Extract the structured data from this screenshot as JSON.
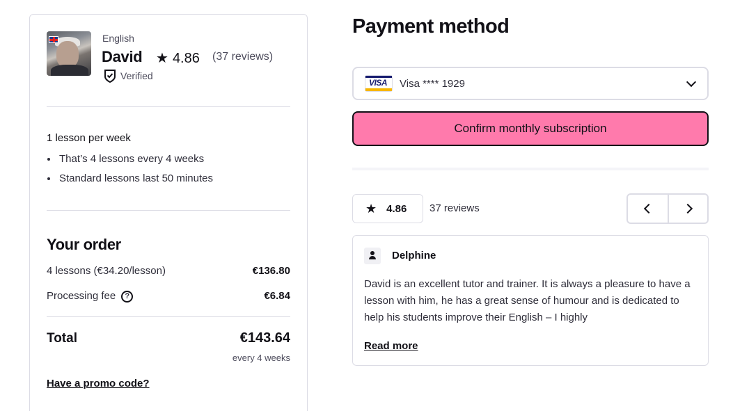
{
  "tutor": {
    "language": "English",
    "name": "David",
    "rating": "4.86",
    "reviews": "(37 reviews)",
    "verified_label": "Verified",
    "avatar_icon": "tutor-photo",
    "flag_icon": "uk-flag-icon"
  },
  "plan": {
    "title": "1 lesson per week",
    "items": [
      "That’s 4 lessons every 4 weeks",
      "Standard lessons last 50 minutes"
    ]
  },
  "order": {
    "title": "Your order",
    "lessons_label": "4 lessons (€34.20/lesson)",
    "lessons_value": "€136.80",
    "fee_label": "Processing fee",
    "fee_value": "€6.84",
    "total_label": "Total",
    "total_value": "€143.64",
    "total_sub": "every 4 weeks",
    "promo_link": "Have a promo code?"
  },
  "payment": {
    "title": "Payment method",
    "card_brand": "VISA",
    "card_label": "Visa **** 1929",
    "confirm_button": "Confirm monthly subscription"
  },
  "reviews_section": {
    "rating": "4.86",
    "count_label": "37 reviews",
    "review": {
      "author": "Delphine",
      "text": "David is an excellent tutor and trainer. It is always a pleasure to have a lesson with him, he has a great sense of humour and is dedicated to help his students improve their English – I highly",
      "read_more": "Read more"
    }
  },
  "colors": {
    "accent_pink": "#ff7aac",
    "border": "#dcdce5",
    "text": "#121117"
  }
}
